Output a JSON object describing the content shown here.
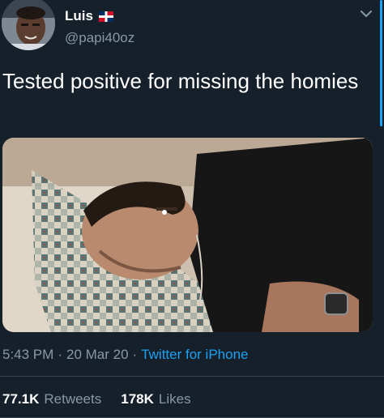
{
  "author": {
    "name": "Luis",
    "handle": "@papi40oz",
    "flag_icon": "dominican-republic-flag-icon",
    "avatar_icon": "profile-photo"
  },
  "tweet": {
    "text": "Tested positive for missing the homies",
    "media_description_icon": "photo-man-sleeping-on-pillow"
  },
  "meta": {
    "time": "5:43 PM",
    "separator": "·",
    "date": "20 Mar 20",
    "source": "Twitter for iPhone"
  },
  "stats": {
    "retweets_count": "77.1K",
    "retweets_label": "Retweets",
    "likes_count": "178K",
    "likes_label": "Likes"
  },
  "colors": {
    "background": "#15202b",
    "secondary_text": "#8899a6",
    "accent": "#1da1f2",
    "divider": "#38444d"
  }
}
